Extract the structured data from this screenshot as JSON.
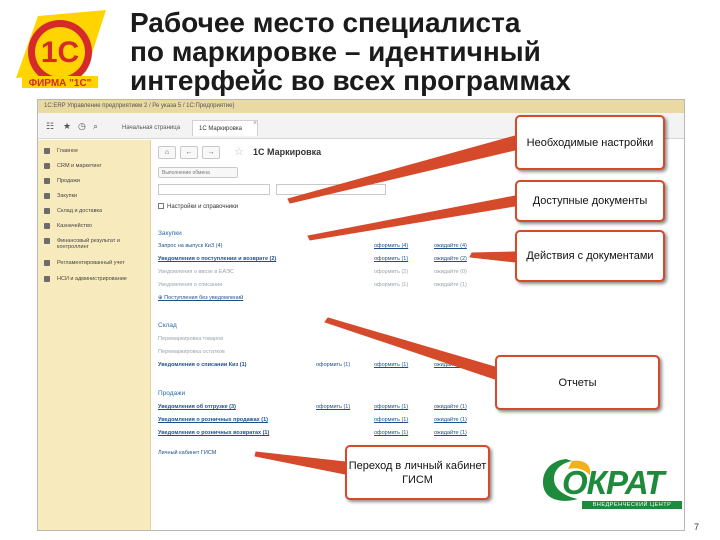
{
  "slide": {
    "title_lines": [
      "Рабочее место специалиста",
      "по маркировке – идентичный",
      "интерфейс во всех программах"
    ],
    "page_number": "7",
    "logo_1c_text": "1С",
    "logo_1c_sub": "ФИРМА \"1С\"",
    "logo_okrat_text": "ОКРАТ",
    "logo_okrat_sub": "ВНЕДРЕНЧЕСКИЙ ЦЕНТР",
    "colors": {
      "callout_border": "#d44a2a",
      "arrow": "#d44a2a",
      "logo_1c_red": "#d6292a",
      "logo_1c_yellow": "#ffd400",
      "okrat_green": "#1e8a3c"
    }
  },
  "callouts": {
    "settings": "Необходимые настройки",
    "docs": "Доступные документы",
    "actions": "Действия с документами",
    "reports": "Отчеты",
    "gis": "Переход в личный кабинет ГИСМ"
  },
  "app": {
    "titlebar": "1С:ERP Управление предприятием 2 / Ре указа 5 / 1С:Предприятие)",
    "tabs": {
      "home": "Начальная страница",
      "active": "1С Маркировка"
    },
    "sidebar": [
      "Главное",
      "CRM и маркетинг",
      "Продажи",
      "Закупки",
      "Склад и доставка",
      "Казначейство",
      "Финансовый результат и контроллинг",
      "Регламентированный учет",
      "НСИ и администрирование"
    ],
    "main_title": "1С Маркировка",
    "filter": {
      "chip1": "Выполнение обмена",
      "select1": "",
      "select2": ""
    },
    "settings_link": "Настройки и справочники",
    "sections": [
      {
        "title": "Закупки",
        "rows": [
          {
            "name": "Запрос на выпуск КиЗ (4)",
            "a1": "оформить (4)",
            "a2": "ожидайте (4)"
          },
          {
            "name": "Уведомления о поступлении и возврате (2)",
            "a1": "оформить (1)",
            "a2": "ожидайте (2)",
            "bold": true
          },
          {
            "name": "Уведомления о ввозе в ЕАЭС",
            "a1": "оформить (2)",
            "a2": "ожидайте (0)",
            "dim": true
          },
          {
            "name": "Уведомления о списании",
            "a1": "оформить (1)",
            "a2": "ожидайте (1)",
            "dim": true
          },
          {
            "name": "Поступления без уведомлений",
            "plus": true
          }
        ]
      },
      {
        "title": "Склад",
        "rows": [
          {
            "name": "Перемаркировка товаров",
            "dim": true
          },
          {
            "name": "Перемаркировка остатков",
            "dim": true
          },
          {
            "name": "Уведомления о списании Киз (1)",
            "a0": "оформить (1)",
            "a1": "оформить (1)",
            "a2": "ожидайте (1)"
          }
        ]
      },
      {
        "title": "Продажи",
        "rows": [
          {
            "name": "Уведомления об отгрузке (3)",
            "a0": "оформить (1)",
            "a1": "оформить (1)",
            "a2": "ожидайте (1)"
          },
          {
            "name": "Уведомления о розничных продажах (1)",
            "a1": "оформить (1)",
            "a2": "ожидайте (1)"
          },
          {
            "name": "Уведомления о розничных возвратах (1)",
            "a1": "оформить (1)",
            "a2": "ожидайте (1)"
          }
        ]
      }
    ],
    "gis_link": "Личный кабинет ГИСМ"
  }
}
